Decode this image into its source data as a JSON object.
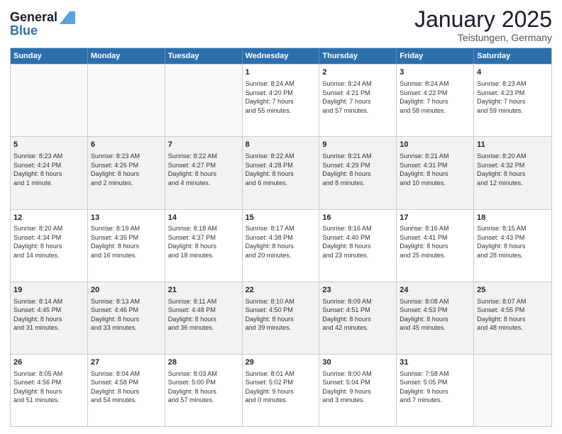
{
  "logo": {
    "general": "General",
    "blue": "Blue"
  },
  "title": "January 2025",
  "location": "Teistungen, Germany",
  "days_of_week": [
    "Sunday",
    "Monday",
    "Tuesday",
    "Wednesday",
    "Thursday",
    "Friday",
    "Saturday"
  ],
  "weeks": [
    [
      {
        "day": "",
        "text": ""
      },
      {
        "day": "",
        "text": ""
      },
      {
        "day": "",
        "text": ""
      },
      {
        "day": "1",
        "text": "Sunrise: 8:24 AM\nSunset: 4:20 PM\nDaylight: 7 hours\nand 55 minutes."
      },
      {
        "day": "2",
        "text": "Sunrise: 8:24 AM\nSunset: 4:21 PM\nDaylight: 7 hours\nand 57 minutes."
      },
      {
        "day": "3",
        "text": "Sunrise: 8:24 AM\nSunset: 4:22 PM\nDaylight: 7 hours\nand 58 minutes."
      },
      {
        "day": "4",
        "text": "Sunrise: 8:23 AM\nSunset: 4:23 PM\nDaylight: 7 hours\nand 59 minutes."
      }
    ],
    [
      {
        "day": "5",
        "text": "Sunrise: 8:23 AM\nSunset: 4:24 PM\nDaylight: 8 hours\nand 1 minute."
      },
      {
        "day": "6",
        "text": "Sunrise: 8:23 AM\nSunset: 4:26 PM\nDaylight: 8 hours\nand 2 minutes."
      },
      {
        "day": "7",
        "text": "Sunrise: 8:22 AM\nSunset: 4:27 PM\nDaylight: 8 hours\nand 4 minutes."
      },
      {
        "day": "8",
        "text": "Sunrise: 8:22 AM\nSunset: 4:28 PM\nDaylight: 8 hours\nand 6 minutes."
      },
      {
        "day": "9",
        "text": "Sunrise: 8:21 AM\nSunset: 4:29 PM\nDaylight: 8 hours\nand 8 minutes."
      },
      {
        "day": "10",
        "text": "Sunrise: 8:21 AM\nSunset: 4:31 PM\nDaylight: 8 hours\nand 10 minutes."
      },
      {
        "day": "11",
        "text": "Sunrise: 8:20 AM\nSunset: 4:32 PM\nDaylight: 8 hours\nand 12 minutes."
      }
    ],
    [
      {
        "day": "12",
        "text": "Sunrise: 8:20 AM\nSunset: 4:34 PM\nDaylight: 8 hours\nand 14 minutes."
      },
      {
        "day": "13",
        "text": "Sunrise: 8:19 AM\nSunset: 4:35 PM\nDaylight: 8 hours\nand 16 minutes."
      },
      {
        "day": "14",
        "text": "Sunrise: 8:18 AM\nSunset: 4:37 PM\nDaylight: 8 hours\nand 18 minutes."
      },
      {
        "day": "15",
        "text": "Sunrise: 8:17 AM\nSunset: 4:38 PM\nDaylight: 8 hours\nand 20 minutes."
      },
      {
        "day": "16",
        "text": "Sunrise: 8:16 AM\nSunset: 4:40 PM\nDaylight: 8 hours\nand 23 minutes."
      },
      {
        "day": "17",
        "text": "Sunrise: 8:16 AM\nSunset: 4:41 PM\nDaylight: 8 hours\nand 25 minutes."
      },
      {
        "day": "18",
        "text": "Sunrise: 8:15 AM\nSunset: 4:43 PM\nDaylight: 8 hours\nand 28 minutes."
      }
    ],
    [
      {
        "day": "19",
        "text": "Sunrise: 8:14 AM\nSunset: 4:45 PM\nDaylight: 8 hours\nand 31 minutes."
      },
      {
        "day": "20",
        "text": "Sunrise: 8:13 AM\nSunset: 4:46 PM\nDaylight: 8 hours\nand 33 minutes."
      },
      {
        "day": "21",
        "text": "Sunrise: 8:11 AM\nSunset: 4:48 PM\nDaylight: 8 hours\nand 36 minutes."
      },
      {
        "day": "22",
        "text": "Sunrise: 8:10 AM\nSunset: 4:50 PM\nDaylight: 8 hours\nand 39 minutes."
      },
      {
        "day": "23",
        "text": "Sunrise: 8:09 AM\nSunset: 4:51 PM\nDaylight: 8 hours\nand 42 minutes."
      },
      {
        "day": "24",
        "text": "Sunrise: 8:08 AM\nSunset: 4:53 PM\nDaylight: 8 hours\nand 45 minutes."
      },
      {
        "day": "25",
        "text": "Sunrise: 8:07 AM\nSunset: 4:55 PM\nDaylight: 8 hours\nand 48 minutes."
      }
    ],
    [
      {
        "day": "26",
        "text": "Sunrise: 8:05 AM\nSunset: 4:56 PM\nDaylight: 8 hours\nand 51 minutes."
      },
      {
        "day": "27",
        "text": "Sunrise: 8:04 AM\nSunset: 4:58 PM\nDaylight: 8 hours\nand 54 minutes."
      },
      {
        "day": "28",
        "text": "Sunrise: 8:03 AM\nSunset: 5:00 PM\nDaylight: 8 hours\nand 57 minutes."
      },
      {
        "day": "29",
        "text": "Sunrise: 8:01 AM\nSunset: 5:02 PM\nDaylight: 9 hours\nand 0 minutes."
      },
      {
        "day": "30",
        "text": "Sunrise: 8:00 AM\nSunset: 5:04 PM\nDaylight: 9 hours\nand 3 minutes."
      },
      {
        "day": "31",
        "text": "Sunrise: 7:58 AM\nSunset: 5:05 PM\nDaylight: 9 hours\nand 7 minutes."
      },
      {
        "day": "",
        "text": ""
      }
    ]
  ]
}
